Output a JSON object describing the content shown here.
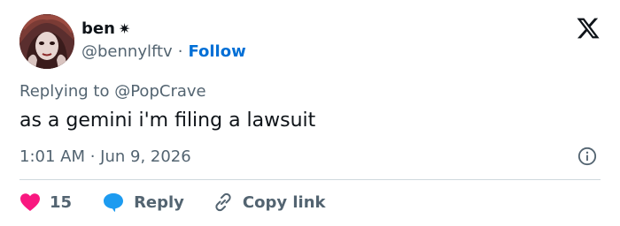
{
  "author": {
    "display_name": "ben",
    "badge_glyph": "✷",
    "handle": "@bennylftv",
    "separator": "·",
    "follow_label": "Follow"
  },
  "tweet": {
    "replying_prefix": "Replying to",
    "replying_to": "@PopCrave",
    "text": "as a gemini i'm filing a lawsuit",
    "timestamp": "1:01 AM · Jun 9, 2026"
  },
  "actions": {
    "like_count": "15",
    "reply_label": "Reply",
    "copy_label": "Copy link"
  },
  "icons": {
    "platform": "x-logo-icon",
    "info": "info-icon",
    "like": "heart-icon",
    "reply": "speech-bubble-icon",
    "copy": "link-icon"
  },
  "colors": {
    "text": "#0f1419",
    "secondary": "#536471",
    "link": "#006fd6",
    "like": "#f91880",
    "reply": "#1d9bf0",
    "divider": "#cfd9de"
  }
}
